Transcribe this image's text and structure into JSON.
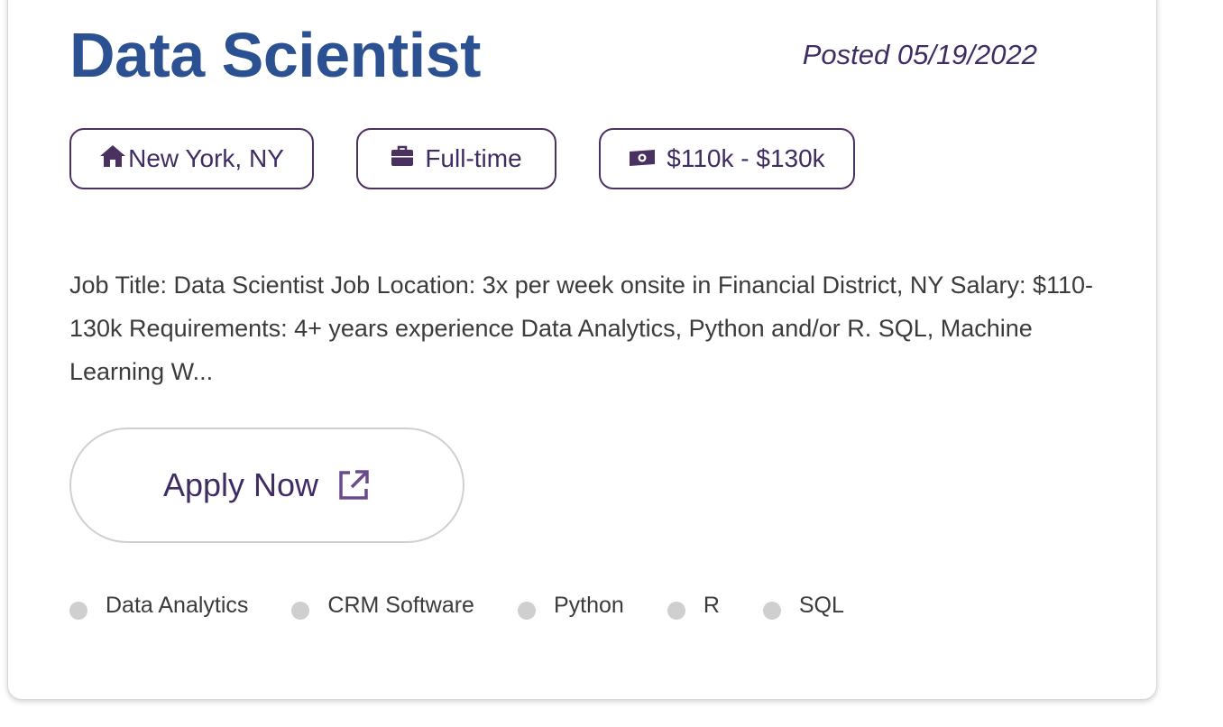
{
  "job": {
    "title": "Data Scientist",
    "posted": "Posted 05/19/2022",
    "location": "New York, NY",
    "employment_type": "Full-time",
    "salary": "$110k - $130k",
    "description": "Job Title: Data Scientist Job Location: 3x per week onsite in Financial District, NY Salary: $110-130k Requirements: 4+ years experience Data Analytics, Python and/or R. SQL, Machine Learning W...",
    "apply_label": "Apply Now",
    "tags": [
      "Data Analytics",
      "CRM Software",
      "Python",
      "R",
      "SQL"
    ]
  },
  "icons": {
    "location": "home-icon",
    "employment_type": "briefcase-icon",
    "salary": "money-bill-icon",
    "apply": "external-link-icon"
  },
  "colors": {
    "title": "#2b5192",
    "accent": "#3f2c63",
    "pill_border": "#4a315f",
    "body_text": "#3b3b3b",
    "tag_dot": "#cfcfcf",
    "card_border": "#d8d8d8"
  }
}
